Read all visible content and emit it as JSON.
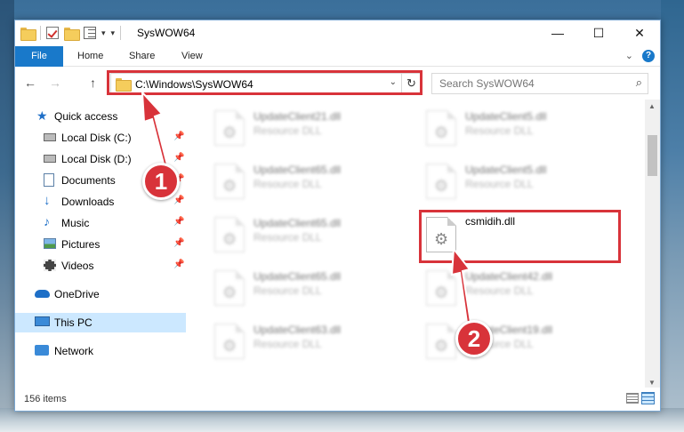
{
  "window": {
    "title": "SysWOW64",
    "controls": {
      "minimize": "—",
      "maximize": "☐",
      "close": "✕"
    }
  },
  "ribbon": {
    "tabs": [
      "File",
      "Home",
      "Share",
      "View"
    ],
    "help": "?"
  },
  "navigation": {
    "back": "←",
    "forward": "→",
    "up": "↑",
    "address": "C:\\Windows\\SysWOW64",
    "search_placeholder": "Search SysWOW64"
  },
  "sidebar": {
    "items": [
      {
        "label": "Quick access",
        "icon": "star-icon",
        "pinned": false
      },
      {
        "label": "Local Disk (C:)",
        "icon": "drive-icon",
        "pinned": true
      },
      {
        "label": "Local Disk (D:)",
        "icon": "drive-icon",
        "pinned": true
      },
      {
        "label": "Documents",
        "icon": "documents-icon",
        "pinned": true
      },
      {
        "label": "Downloads",
        "icon": "download-icon",
        "pinned": true
      },
      {
        "label": "Music",
        "icon": "music-icon",
        "pinned": true
      },
      {
        "label": "Pictures",
        "icon": "pictures-icon",
        "pinned": true
      },
      {
        "label": "Videos",
        "icon": "videos-icon",
        "pinned": true
      },
      {
        "label": "OneDrive",
        "icon": "cloud-icon",
        "pinned": false
      },
      {
        "label": "This PC",
        "icon": "computer-icon",
        "pinned": false,
        "selected": true
      },
      {
        "label": "Network",
        "icon": "network-icon",
        "pinned": false
      }
    ]
  },
  "files": [
    {
      "name": "UpdateClient21.dll",
      "type": "Resource DLL"
    },
    {
      "name": "UpdateClient5.dll",
      "type": "Resource DLL"
    },
    {
      "name": "UpdateClient65.dll",
      "type": "Resource DLL"
    },
    {
      "name": "UpdateClient5.dll",
      "type": "Resource DLL"
    },
    {
      "name": "UpdateClient65.dll",
      "type": "Resource DLL"
    },
    {
      "name": "csmidih.dll",
      "type": "",
      "highlighted": true
    },
    {
      "name": "UpdateClient65.dll",
      "type": "Resource DLL"
    },
    {
      "name": "UpdateClient42.dll",
      "type": "Resource DLL"
    },
    {
      "name": "UpdateClient63.dll",
      "type": "Resource DLL"
    },
    {
      "name": "UpdateClient19.dll",
      "type": "Resource DLL"
    }
  ],
  "status": {
    "item_count": "156 items"
  },
  "annotations": {
    "step1": "1",
    "step2": "2",
    "color": "#d8333a"
  }
}
